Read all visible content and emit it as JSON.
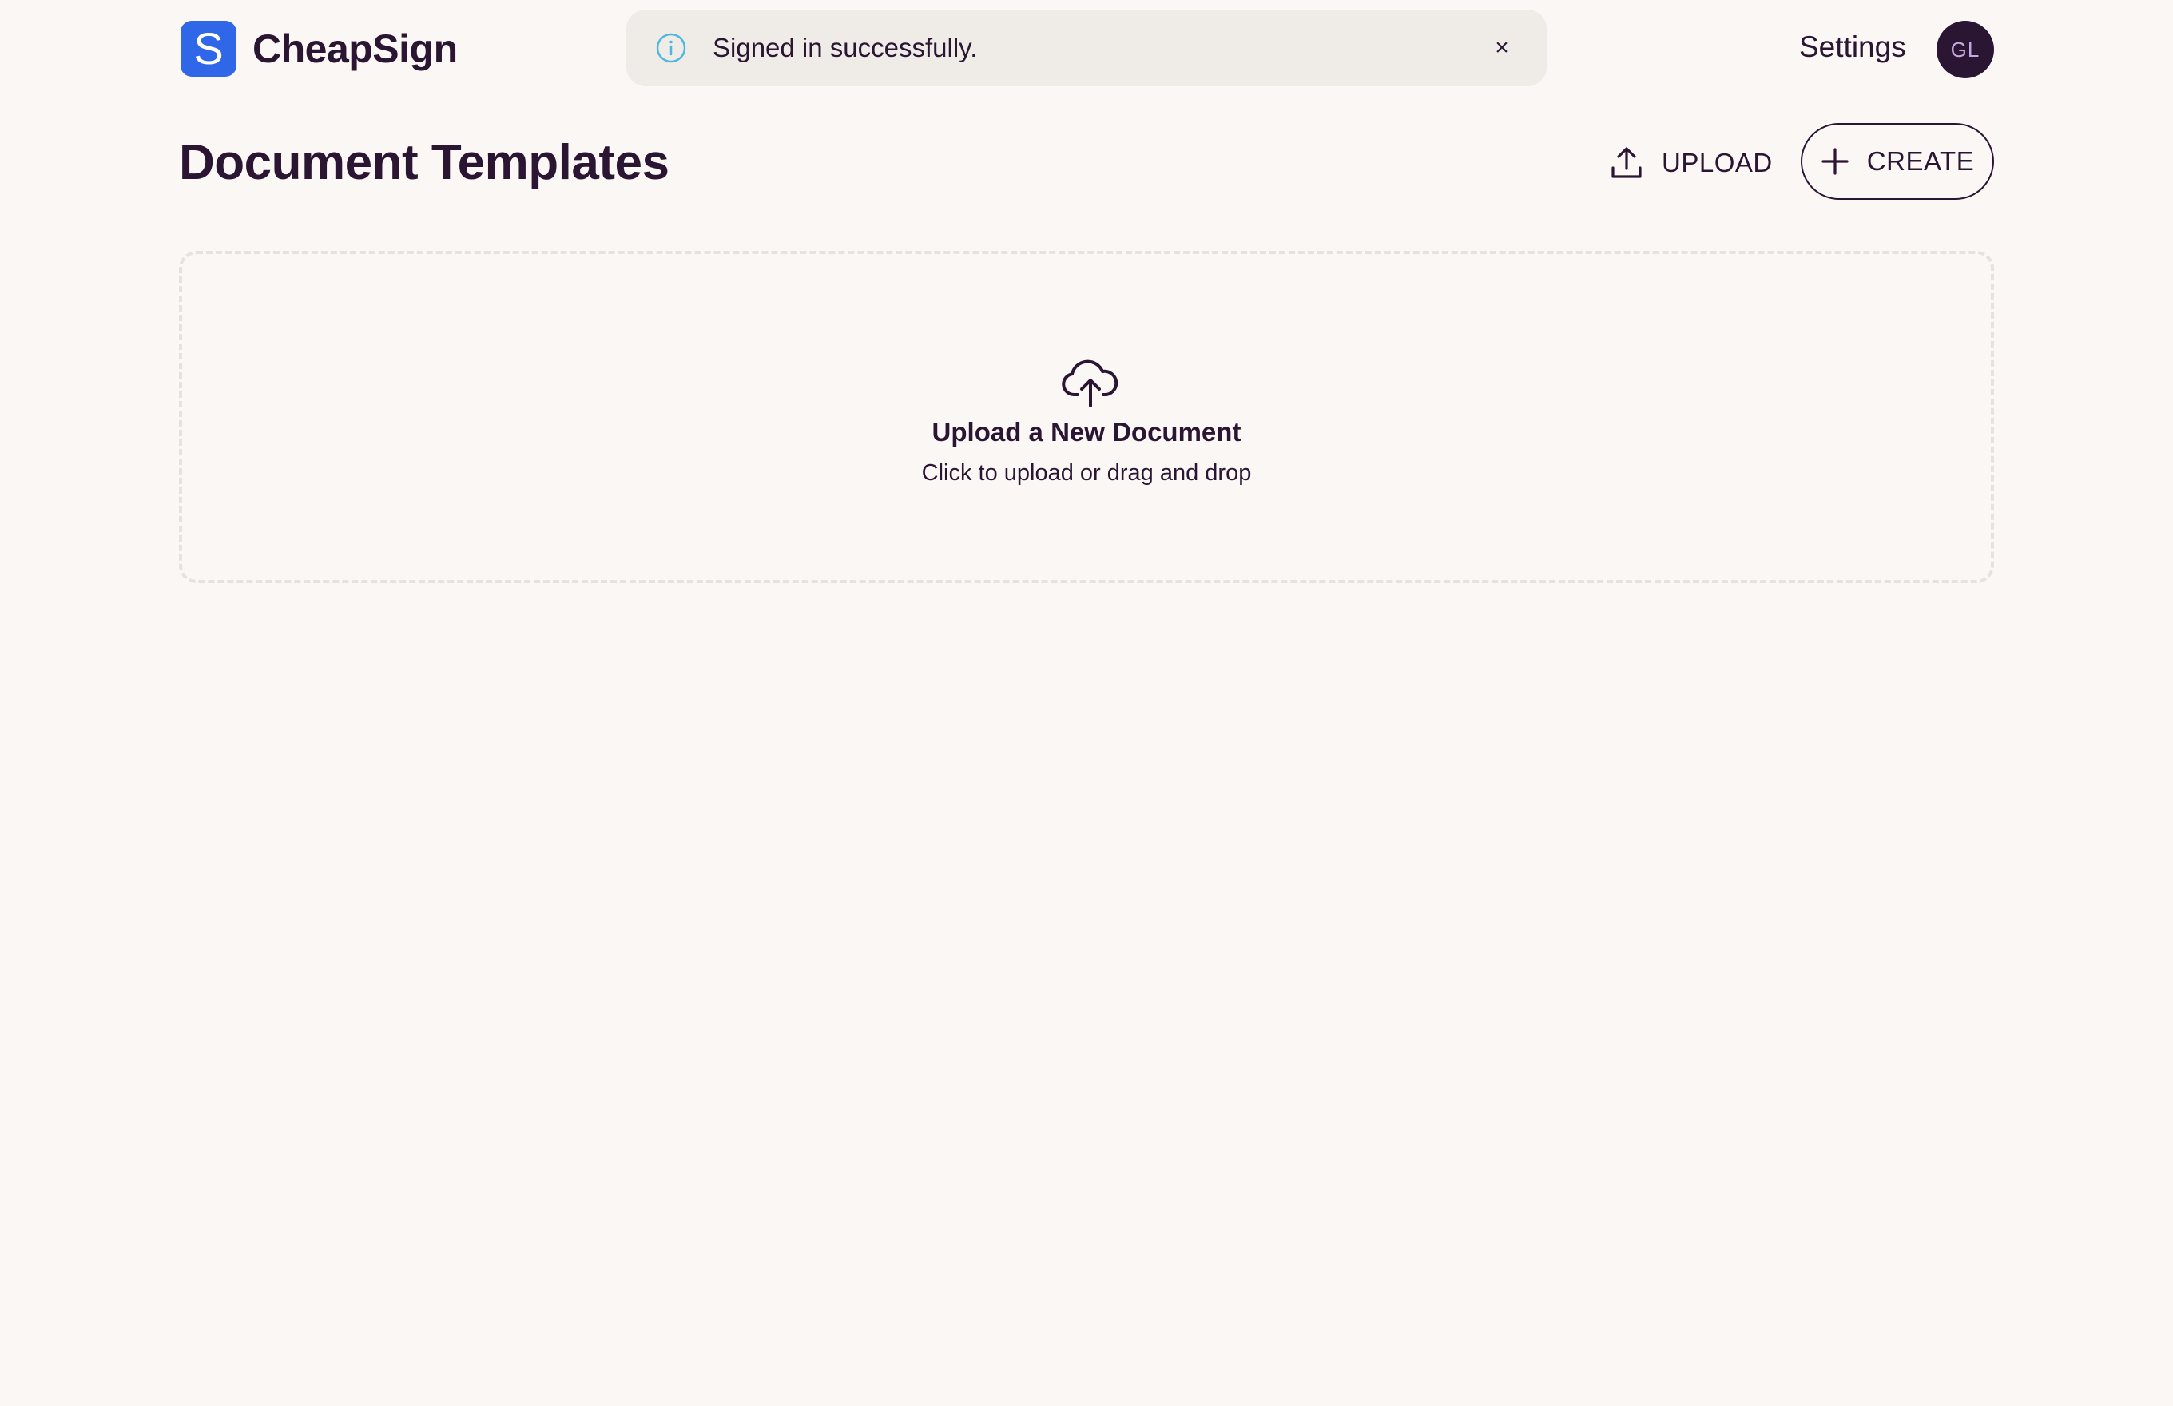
{
  "header": {
    "logo_letter": "S",
    "app_name": "CheapSign",
    "settings_label": "Settings",
    "avatar_initials": "GL"
  },
  "toast": {
    "message": "Signed in successfully.",
    "close_glyph": "×",
    "icon": "info-icon",
    "accent_color": "#4fb6e0"
  },
  "main": {
    "title": "Document Templates",
    "upload_label": "UPLOAD",
    "create_label": "CREATE"
  },
  "dropzone": {
    "title": "Upload a New Document",
    "subtitle": "Click to upload or drag and drop",
    "icon": "cloud-upload-icon"
  },
  "colors": {
    "brand": "#2f67e8",
    "text": "#2a1533",
    "background": "#faf7f4"
  }
}
